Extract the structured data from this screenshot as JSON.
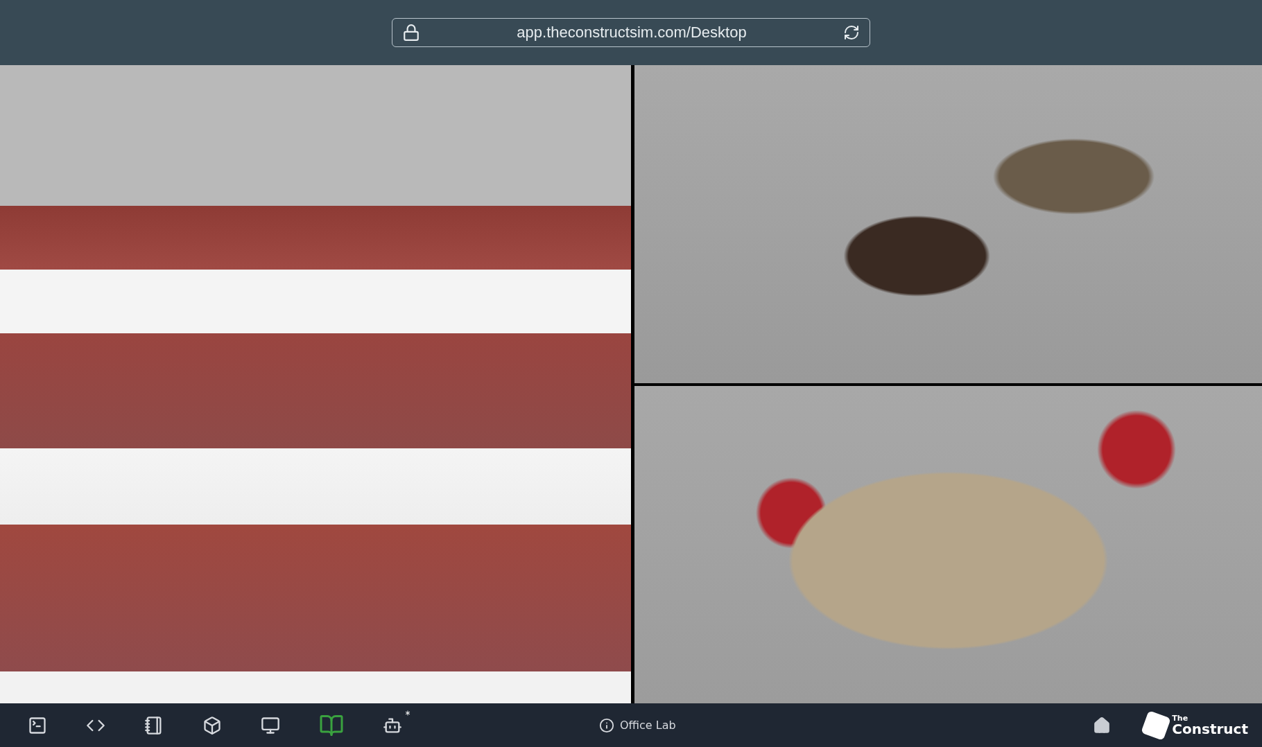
{
  "address_bar": {
    "url": "app.theconstructsim.com/Desktop"
  },
  "toolbar": {
    "tools": [
      {
        "kind": "terminal",
        "active": false,
        "badge": false
      },
      {
        "kind": "code",
        "active": false,
        "badge": false
      },
      {
        "kind": "notebook",
        "active": false,
        "badge": false
      },
      {
        "kind": "cube",
        "active": false,
        "badge": false
      },
      {
        "kind": "monitor",
        "active": false,
        "badge": false
      },
      {
        "kind": "book",
        "active": true,
        "badge": false
      },
      {
        "kind": "robot",
        "active": false,
        "badge": true
      }
    ],
    "project_name": "Office Lab",
    "logo": {
      "small": "The",
      "large": "Construct"
    }
  }
}
